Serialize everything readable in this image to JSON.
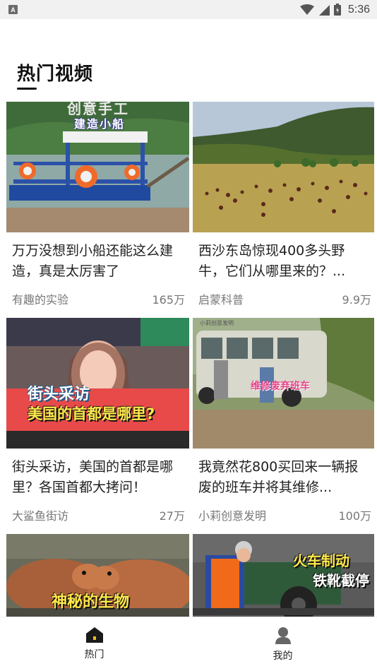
{
  "status_bar": {
    "app_icon_letter": "A",
    "time": "5:36",
    "icons": [
      "wifi-icon",
      "signal-icon",
      "battery-icon"
    ]
  },
  "page": {
    "title": "热门视频"
  },
  "videos": [
    {
      "title": "万万没想到小船还能这么建造，真是太厉害了",
      "author": "有趣的实验",
      "views": "165万",
      "thumb_caption": "建造小船",
      "thumb_top_text": "创意手工"
    },
    {
      "title": "西沙东岛惊现400多头野牛，它们从哪里来的？...",
      "author": "启蒙科普",
      "views": "9.9万",
      "thumb_caption": "",
      "thumb_top_text": ""
    },
    {
      "title": "街头采访，美国的首都是哪里？各国首都大拷问！",
      "author": "大鲨鱼街访",
      "views": "27万",
      "thumb_caption": "街头采访",
      "thumb_sub_caption": "美国的首都是哪里?"
    },
    {
      "title": "我竟然花800买回来一辆报废的班车并将其维修...",
      "author": "小莉创意发明",
      "views": "100万",
      "thumb_caption": "维修废弃班车",
      "thumb_top_text": "小莉创意发明"
    },
    {
      "title": "",
      "author": "",
      "views": "",
      "thumb_caption": "神秘的生物"
    },
    {
      "title": "",
      "author": "",
      "views": "",
      "thumb_caption": "火车制动",
      "thumb_sub_caption": "铁靴截停"
    }
  ],
  "tab_bar": {
    "tabs": [
      {
        "label": "热门",
        "icon": "home-icon",
        "active": true
      },
      {
        "label": "我的",
        "icon": "user-icon",
        "active": false
      }
    ]
  },
  "colors": {
    "accent": "#111111",
    "tab_icon_active": "#1a1a1a",
    "tab_icon_inactive": "#666666"
  }
}
